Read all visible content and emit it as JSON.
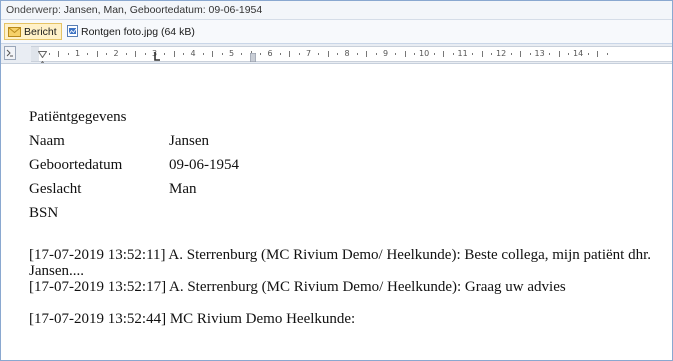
{
  "subject": {
    "label": "Onderwerp:",
    "value": "Jansen, Man, Geboortedatum: 09-06-1954"
  },
  "tabs": [
    {
      "label": "Bericht",
      "icon": "envelope-icon",
      "active": true
    },
    {
      "label": "Rontgen foto.jpg (64 kB)",
      "icon": "image-file-icon",
      "active": false
    }
  ],
  "ruler": {
    "numbers": [
      "1",
      "2",
      "3",
      "4",
      "5",
      "6",
      "7",
      "8",
      "9",
      "10",
      "11",
      "12",
      "13",
      "14"
    ]
  },
  "patient": {
    "heading": "Patiëntgegevens",
    "fields": [
      {
        "label": "Naam",
        "value": "Jansen"
      },
      {
        "label": "Geboortedatum",
        "value": "09-06-1954"
      },
      {
        "label": "Geslacht",
        "value": "Man"
      },
      {
        "label": "BSN",
        "value": ""
      }
    ]
  },
  "messages": [
    "[17-07-2019 13:52:11] A. Sterrenburg (MC Rivium Demo/ Heelkunde): Beste collega, mijn patiënt dhr. Jansen....",
    "[17-07-2019 13:52:17] A. Sterrenburg (MC Rivium Demo/ Heelkunde): Graag uw advies",
    "[17-07-2019 13:52:44] MC Rivium Demo Heelkunde:"
  ],
  "colors": {
    "active_tab_bg": "#fff1c8",
    "frame_border": "#8aa8d0"
  }
}
